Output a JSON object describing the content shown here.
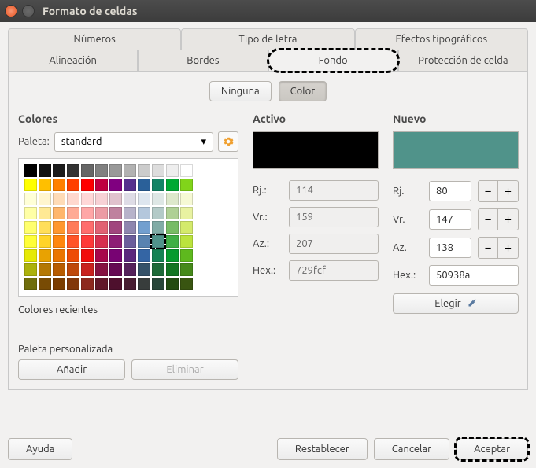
{
  "window": {
    "title": "Formato de celdas"
  },
  "tabs_top": [
    "Números",
    "Tipo de letra",
    "Efectos tipográficos"
  ],
  "tabs_bottom": [
    "Alineación",
    "Bordes",
    "Fondo",
    "Protección de celda"
  ],
  "active_tab": "Fondo",
  "mode": {
    "none": "Ninguna",
    "color": "Color"
  },
  "colors": {
    "heading": "Colores",
    "palette_label": "Paleta:",
    "palette_value": "standard",
    "recent": "Colores recientes",
    "custom_heading": "Paleta personalizada",
    "add": "Añadir",
    "remove": "Eliminar"
  },
  "active": {
    "heading": "Activo",
    "color": "#000000",
    "r_label": "Rj.:",
    "r": "114",
    "g_label": "Vr.:",
    "g": "159",
    "b_label": "Az.:",
    "b": "207",
    "hex_label": "Hex.:",
    "hex": "729fcf"
  },
  "nuevo": {
    "heading": "Nuevo",
    "color": "#50938a",
    "r_label": "Rj.",
    "r": "80",
    "g_label": "Vr.",
    "g": "147",
    "b_label": "Az.",
    "b": "138",
    "hex_label": "Hex.:",
    "hex": "50938a",
    "pick": "Elegir"
  },
  "footer": {
    "help": "Ayuda",
    "reset": "Restablecer",
    "cancel": "Cancelar",
    "ok": "Aceptar"
  },
  "swatch_rows": [
    [
      "#000000",
      "#111111",
      "#1c1c1c",
      "#333333",
      "#666666",
      "#808080",
      "#999999",
      "#b2b2b2",
      "#cccccc",
      "#dddddd",
      "#eeeeee",
      "#ffffff"
    ],
    [
      "#ffff00",
      "#ffbf00",
      "#ff8000",
      "#ff4000",
      "#ff0000",
      "#bf0041",
      "#800080",
      "#55308d",
      "#2a6099",
      "#158466",
      "#00a933",
      "#81d41a"
    ],
    [
      "#ffffd7",
      "#fff5ce",
      "#ffdbb6",
      "#ffd8ce",
      "#ffd7d7",
      "#f7d1d5",
      "#e0c2cd",
      "#dedce6",
      "#dee6ef",
      "#dee7e5",
      "#dde8cb",
      "#f6f9d4"
    ],
    [
      "#ffffa6",
      "#ffe994",
      "#ffb66c",
      "#ffaa95",
      "#ffa6a6",
      "#ec9ba4",
      "#bf819e",
      "#b7b3ca",
      "#b4c7dc",
      "#b3cac7",
      "#afd095",
      "#e8f2a1"
    ],
    [
      "#ffff6d",
      "#ffde59",
      "#ff972f",
      "#ff7b59",
      "#ff6d6d",
      "#e16173",
      "#a1467e",
      "#8e86ae",
      "#729fcf",
      "#81aca6",
      "#77bc65",
      "#d4ea6b"
    ],
    [
      "#ffff38",
      "#ffd428",
      "#ff860d",
      "#ff5429",
      "#ff3838",
      "#d62e4e",
      "#8d1d75",
      "#6b5e9b",
      "#5983b0",
      "#50938a",
      "#3faf46",
      "#bbe33d"
    ],
    [
      "#e6e905",
      "#e8a202",
      "#ea7500",
      "#ed4c05",
      "#f10d0c",
      "#a7074b",
      "#780373",
      "#5b277d",
      "#3465a4",
      "#168253",
      "#069a2e",
      "#5eb91e"
    ],
    [
      "#acb20c",
      "#b47804",
      "#b85c00",
      "#be480a",
      "#c9211e",
      "#861141",
      "#650953",
      "#55215b",
      "#355269",
      "#1e6a39",
      "#127622",
      "#468a1a"
    ],
    [
      "#706e0c",
      "#784b04",
      "#7b3d00",
      "#813709",
      "#8d281e",
      "#611729",
      "#4e102d",
      "#481d32",
      "#383d3c",
      "#28463a",
      "#224b12",
      "#395511"
    ]
  ],
  "selected_swatch": {
    "row": 5,
    "col": 9
  }
}
